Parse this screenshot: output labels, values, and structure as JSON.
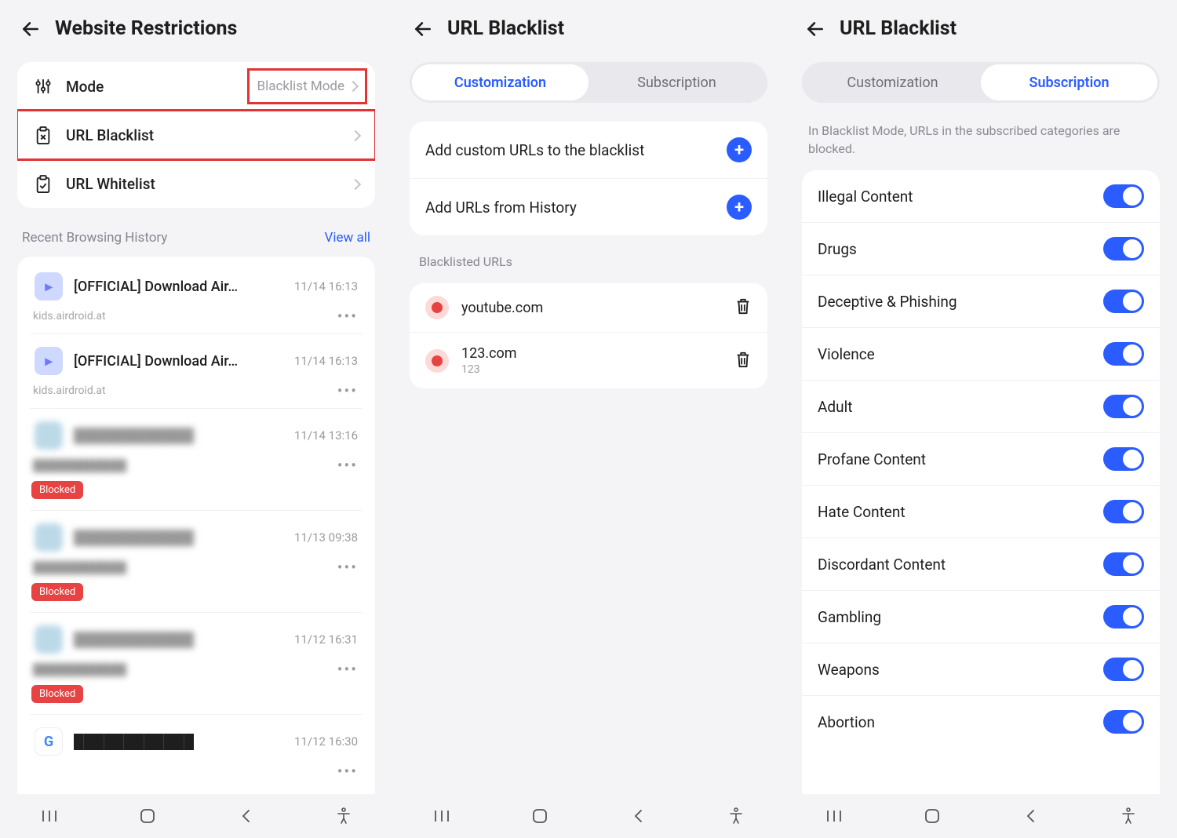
{
  "panel1": {
    "title": "Website Restrictions",
    "mode": {
      "label": "Mode",
      "value": "Blacklist Mode"
    },
    "blacklist_label": "URL Blacklist",
    "whitelist_label": "URL Whitelist",
    "recent_label": "Recent Browsing History",
    "view_all": "View all",
    "history": [
      {
        "title": "[OFFICIAL] Download Air…",
        "time": "11/14 16:13",
        "sub": "kids.airdroid.at",
        "blocked": false,
        "app": "airdroid"
      },
      {
        "title": "[OFFICIAL] Download Air…",
        "time": "11/14 16:13",
        "sub": "kids.airdroid.at",
        "blocked": false,
        "app": "airdroid"
      },
      {
        "title": "████████████",
        "time": "11/14 13:16",
        "sub": "████████████",
        "blocked": true,
        "app": "blur"
      },
      {
        "title": "████████████",
        "time": "11/13 09:38",
        "sub": "████████████",
        "blocked": true,
        "app": "blur"
      },
      {
        "title": "████████████",
        "time": "11/12 16:31",
        "sub": "████████████",
        "blocked": true,
        "app": "blur"
      },
      {
        "title": "████████████",
        "time": "11/12 16:30",
        "sub": "",
        "blocked": false,
        "app": "google"
      }
    ],
    "blocked_badge": "Blocked"
  },
  "panel2": {
    "title": "URL Blacklist",
    "tabs": {
      "a": "Customization",
      "b": "Subscription"
    },
    "add_custom": "Add custom URLs to the blacklist",
    "add_history": "Add URLs from History",
    "list_label": "Blacklisted URLs",
    "urls": [
      {
        "main": "youtube.com",
        "sub": ""
      },
      {
        "main": "123.com",
        "sub": "123"
      }
    ]
  },
  "panel3": {
    "title": "URL Blacklist",
    "tabs": {
      "a": "Customization",
      "b": "Subscription"
    },
    "desc": "In Blacklist Mode, URLs in the subscribed categories are blocked.",
    "categories": [
      "Illegal Content",
      "Drugs",
      "Deceptive & Phishing",
      "Violence",
      "Adult",
      "Profane Content",
      "Hate Content",
      "Discordant Content",
      "Gambling",
      "Weapons",
      "Abortion"
    ]
  }
}
